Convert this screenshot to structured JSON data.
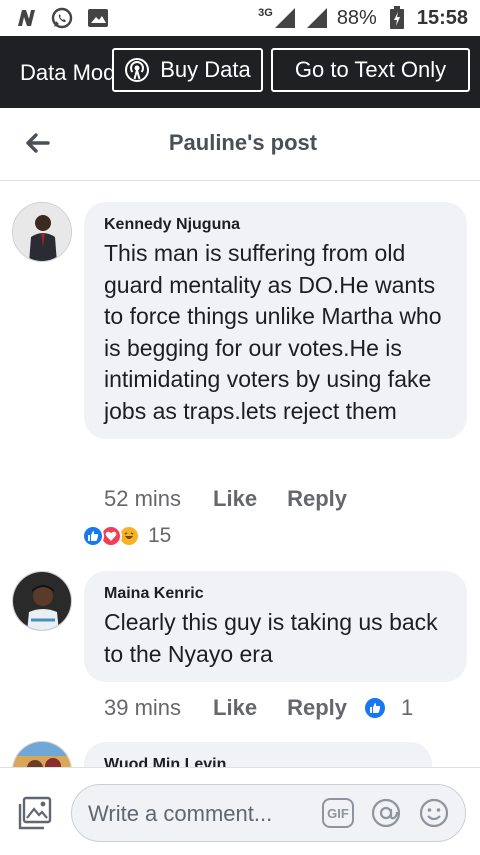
{
  "status_bar": {
    "network": "3G",
    "battery_pct": "88%",
    "time": "15:58",
    "icons": [
      "n-app-icon",
      "whatsapp-icon",
      "gallery-icon",
      "signal-icon",
      "battery-icon"
    ]
  },
  "data_bar": {
    "mode_label": "Data Mode",
    "buy_label": "Buy Data",
    "text_only_label": "Go to Text Only"
  },
  "header": {
    "title": "Pauline's post"
  },
  "comments": [
    {
      "author": "Kennedy Njuguna",
      "text": "This man is suffering from old guard mentality as DO.He wants to force things unlike Martha who is begging for our votes.He is intimidating voters by using fake jobs as traps.lets reject them",
      "time": "52 mins",
      "like_label": "Like",
      "reply_label": "Reply",
      "reactions_count": "15",
      "reaction_icons": [
        "like-reaction-icon",
        "love-reaction-icon",
        "haha-reaction-icon"
      ]
    },
    {
      "author": "Maina Kenric",
      "text": "Clearly this guy is taking us back to the Nyayo era",
      "time": "39 mins",
      "like_label": "Like",
      "reply_label": "Reply",
      "reactions_count": "1",
      "reaction_icons": [
        "like-reaction-icon"
      ]
    },
    {
      "author": "Wuod Min Levin"
    }
  ],
  "composer": {
    "placeholder": "Write a comment...",
    "gif_label": "GIF"
  },
  "colors": {
    "data_bar_bg": "#1f2023",
    "bubble_bg": "#f0f2f5",
    "like_blue": "#1877f2",
    "love_red": "#f33e58",
    "haha_yellow": "#f7b125"
  }
}
